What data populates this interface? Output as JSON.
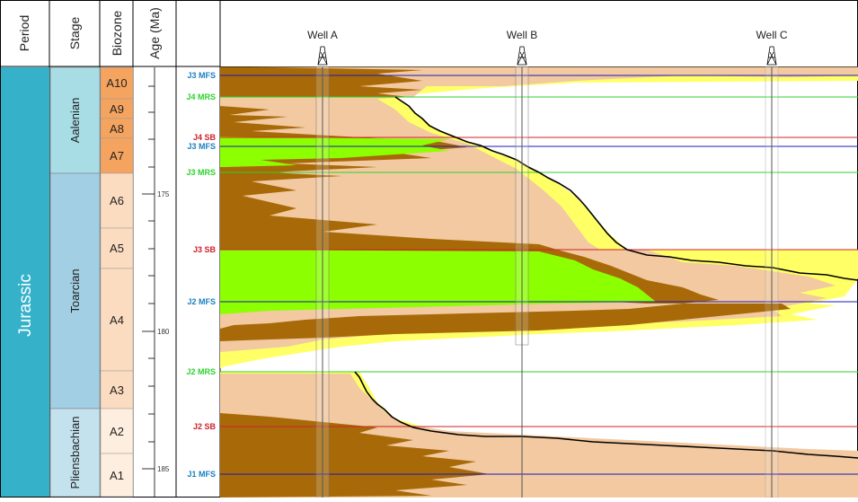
{
  "headers": {
    "period": "Period",
    "stage": "Stage",
    "biozone": "Biozone",
    "age": "Age (Ma)"
  },
  "period": {
    "name": "Jurassic",
    "color": "#35b2c9"
  },
  "stages": [
    {
      "id": "aalenian",
      "name": "Aalenian",
      "color": "#a8dde6"
    },
    {
      "id": "toarcian",
      "name": "Toarcian",
      "color": "#a2cfe3"
    },
    {
      "id": "pliensbachian",
      "name": "Pliensbachian",
      "color": "#c3e2ee"
    }
  ],
  "biozones": [
    {
      "id": "a10",
      "name": "A10"
    },
    {
      "id": "a9",
      "name": "A9"
    },
    {
      "id": "a8",
      "name": "A8"
    },
    {
      "id": "a7",
      "name": "A7"
    },
    {
      "id": "a6",
      "name": "A6"
    },
    {
      "id": "a5",
      "name": "A5"
    },
    {
      "id": "a4",
      "name": "A4"
    },
    {
      "id": "a3",
      "name": "A3"
    },
    {
      "id": "a2",
      "name": "A2"
    },
    {
      "id": "a1",
      "name": "A1"
    }
  ],
  "age_labels": [
    "175",
    "180",
    "185"
  ],
  "wells": [
    {
      "id": "a",
      "name": "Well A"
    },
    {
      "id": "b",
      "name": "Well B"
    },
    {
      "id": "c",
      "name": "Well C"
    }
  ],
  "surfaces": [
    {
      "id": "j3-mfs-top",
      "name": "J3 MFS",
      "type": "MFS"
    },
    {
      "id": "j4-mrs",
      "name": "J4 MRS",
      "type": "MRS"
    },
    {
      "id": "j4-sb",
      "name": "J4 SB",
      "type": "SB"
    },
    {
      "id": "j3-mfs",
      "name": "J3 MFS",
      "type": "MFS"
    },
    {
      "id": "j3-mrs",
      "name": "J3 MRS",
      "type": "MRS"
    },
    {
      "id": "j3-sb",
      "name": "J3 SB",
      "type": "SB"
    },
    {
      "id": "j2-mfs",
      "name": "J2 MFS",
      "type": "MFS"
    },
    {
      "id": "j2-mrs",
      "name": "J2 MRS",
      "type": "MRS"
    },
    {
      "id": "j2-sb",
      "name": "J2 SB",
      "type": "SB"
    },
    {
      "id": "j1-mfs",
      "name": "J1 MFS",
      "type": "MFS"
    }
  ],
  "colors": {
    "sb": "#d0202a",
    "mfs_label": "#1a7fc0",
    "mfs_line": "#1a1ab4",
    "mrs": "#2cd22c",
    "brown": "#a86a08",
    "tan": "#f2c9a0",
    "yellow": "#ffff66",
    "green": "#8cff00",
    "biozone_dark": "#f5a460",
    "biozone_light": "#fcdcc0",
    "biozone_pale": "#fdeee0"
  }
}
